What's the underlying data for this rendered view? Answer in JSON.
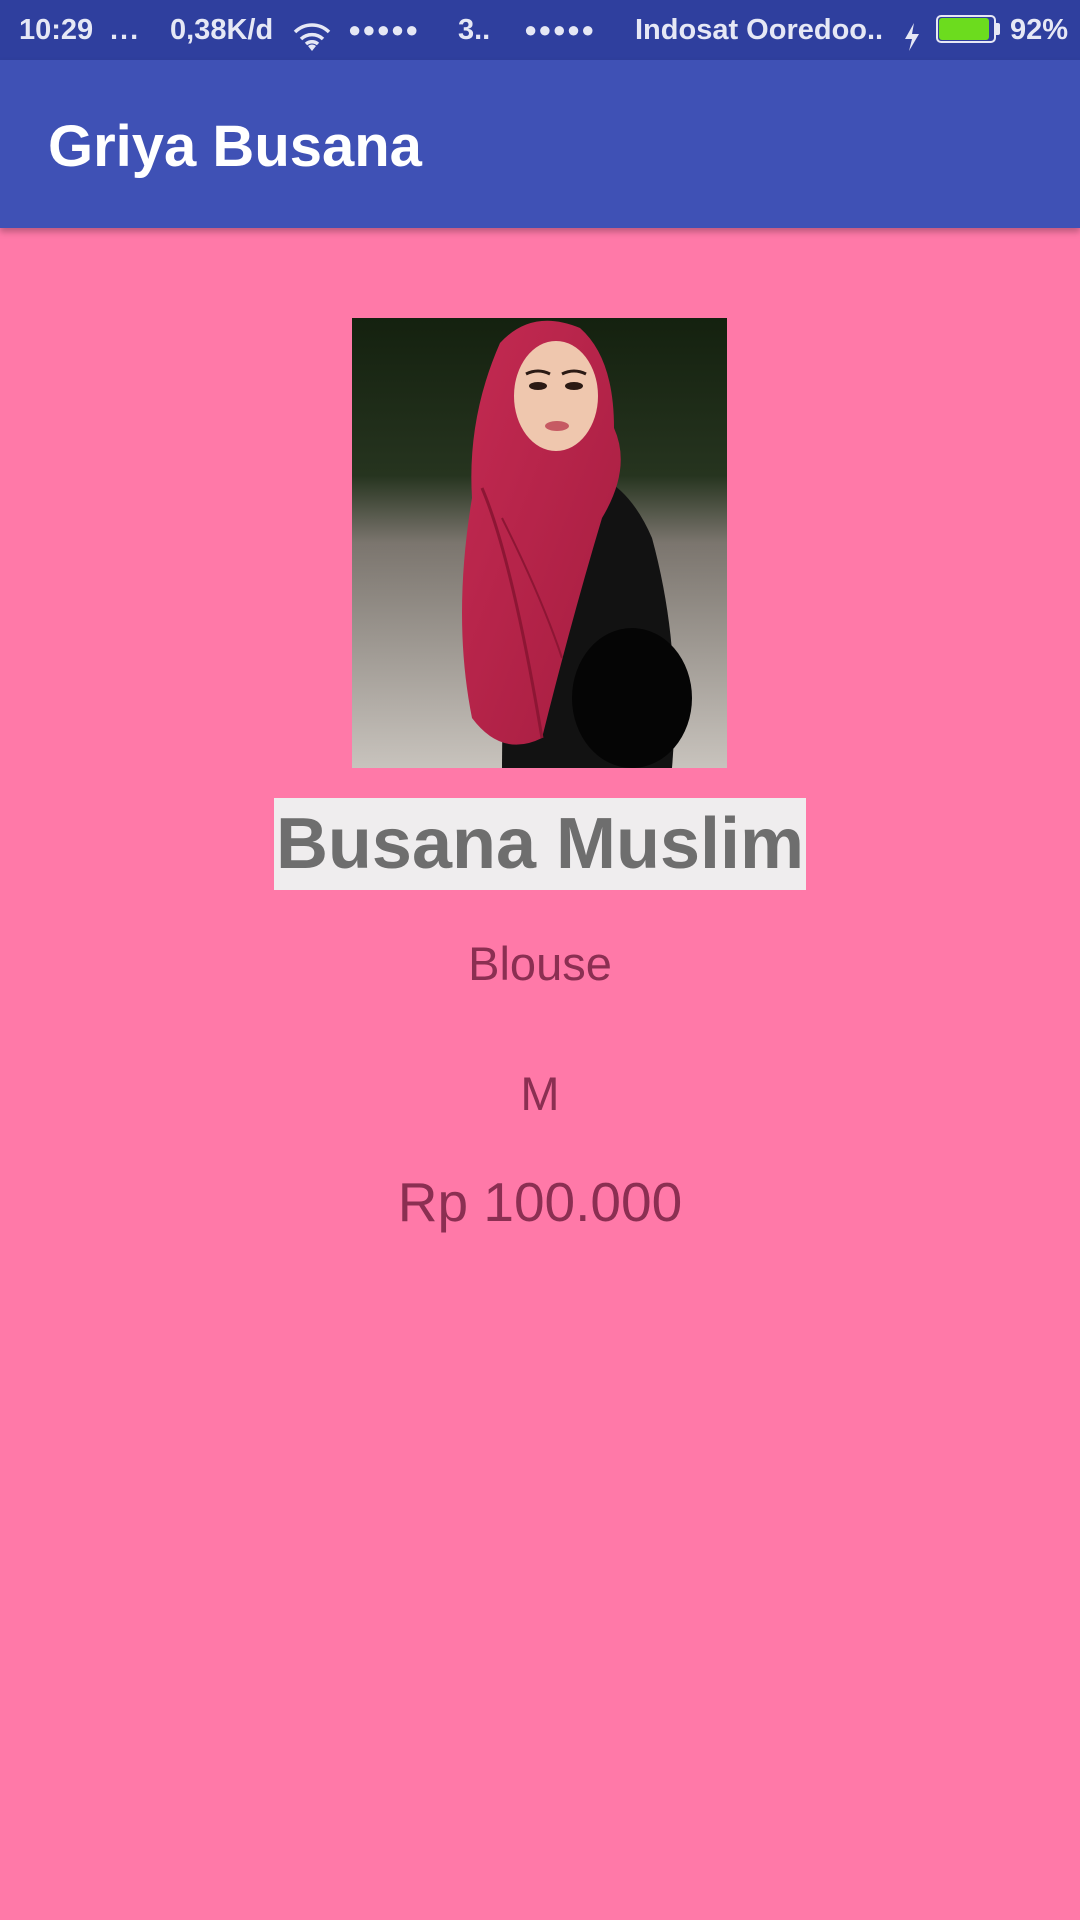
{
  "status_bar": {
    "time": "10:29",
    "dots": "...",
    "speed": "0,38K/d",
    "signal_1": "●●●●●",
    "network": "3..",
    "signal_2": "●●●●●",
    "carrier": "Indosat Ooredoo..",
    "battery_percent": "92%",
    "battery_level": 0.92,
    "battery_color": "#6cdc1e",
    "icons": [
      "wifi-icon",
      "charging-icon",
      "battery-icon"
    ]
  },
  "app_bar": {
    "title": "Griya Busana",
    "color": "#3f51b5"
  },
  "product": {
    "image_icon": "product-photo-hijab",
    "name": "Busana Muslim",
    "category": "Blouse",
    "size": "M",
    "price": "Rp 100.000"
  },
  "colors": {
    "background": "#ff79a8",
    "text": "#8b2f52",
    "status_bar": "#2f3f9e"
  }
}
